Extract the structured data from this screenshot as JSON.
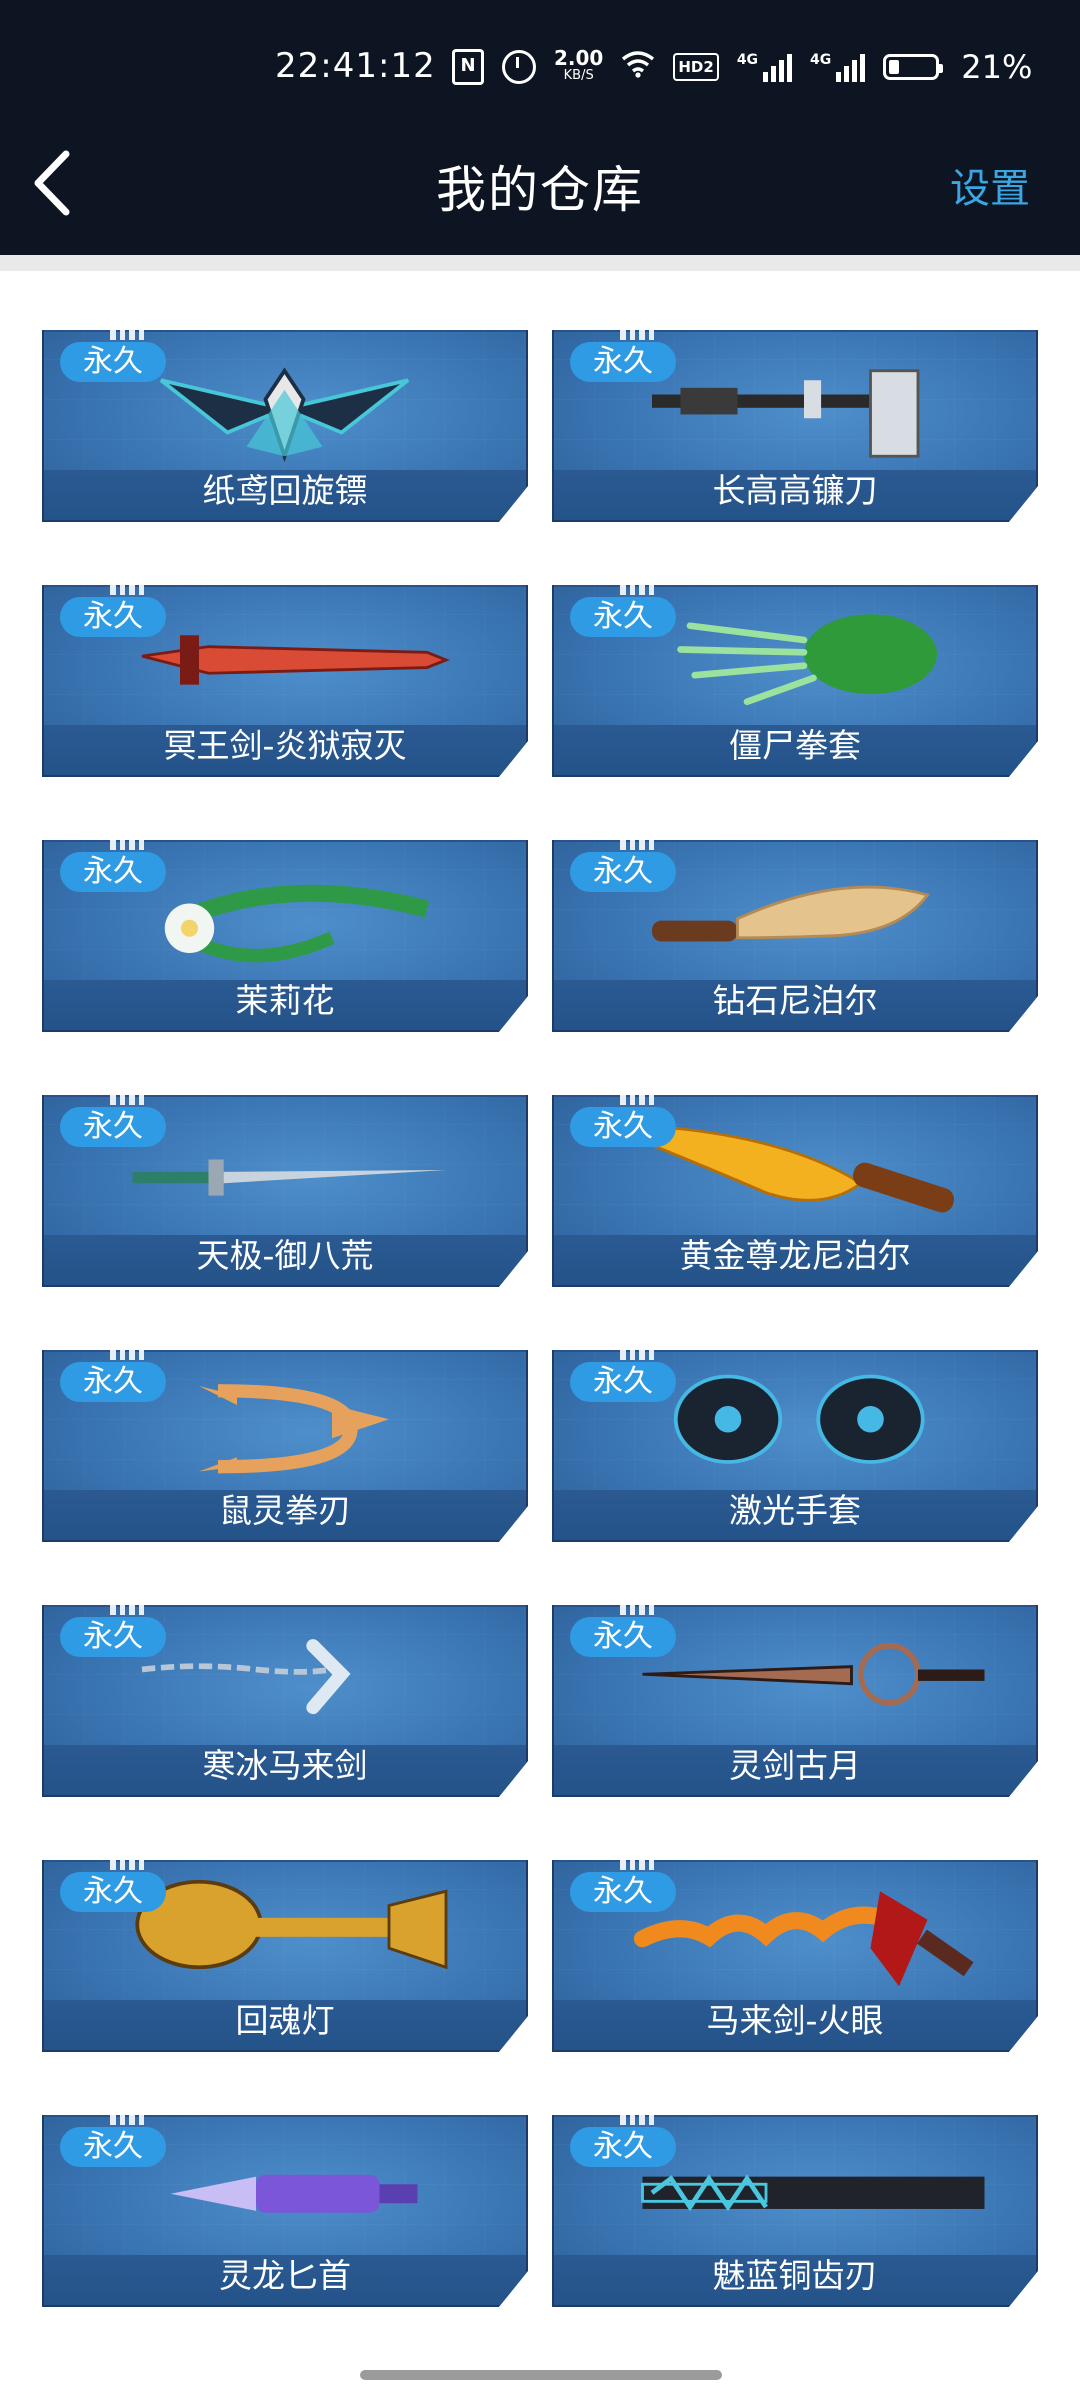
{
  "status_bar": {
    "time": "22:41:12",
    "nfc_label": "N",
    "speed_value": "2.00",
    "speed_unit": "KB/S",
    "hd_label": "HD2",
    "signal1_label": "4G",
    "signal2_label": "4G",
    "battery_percent": "21%",
    "battery_level": 0.21
  },
  "header": {
    "title": "我的仓库",
    "settings_label": "设置",
    "back_icon": "chevron-left-icon"
  },
  "badge_label": "永久",
  "items": [
    {
      "name": "纸鸢回旋镖",
      "color": "#1c2f44",
      "accent": "#47c7d7",
      "shape": "kite"
    },
    {
      "name": "长高高镰刀",
      "color": "#d7dde3",
      "accent": "#2a2a2a",
      "shape": "scythe"
    },
    {
      "name": "冥王剑-炎狱寂灭",
      "color": "#d94b34",
      "accent": "#7a1c15",
      "shape": "sword"
    },
    {
      "name": "僵尸拳套",
      "color": "#2e9a3a",
      "accent": "#9be29f",
      "shape": "claw"
    },
    {
      "name": "茉莉花",
      "color": "#2e9a48",
      "accent": "#f2f6f2",
      "shape": "flower"
    },
    {
      "name": "钻石尼泊尔",
      "color": "#e5c38d",
      "accent": "#6a3b1f",
      "shape": "kukri"
    },
    {
      "name": "天极-御八荒",
      "color": "#c9d3dd",
      "accent": "#2d7f69",
      "shape": "rapier"
    },
    {
      "name": "黄金尊龙尼泊尔",
      "color": "#f3b01f",
      "accent": "#7a3d16",
      "shape": "kukri-gold"
    },
    {
      "name": "鼠灵拳刃",
      "color": "#e6a25c",
      "accent": "#2b2b2b",
      "shape": "knuckle"
    },
    {
      "name": "激光手套",
      "color": "#1a2330",
      "accent": "#46b8e5",
      "shape": "gloves"
    },
    {
      "name": "寒冰马来剑",
      "color": "#dfe9f3",
      "accent": "#b8c7d6",
      "shape": "ice-sword"
    },
    {
      "name": "灵剑古月",
      "color": "#a46a52",
      "accent": "#2c1b16",
      "shape": "long-sword"
    },
    {
      "name": "回魂灯",
      "color": "#d9a22d",
      "accent": "#5a3c10",
      "shape": "lamp"
    },
    {
      "name": "马来剑-火眼",
      "color": "#f08a1f",
      "accent": "#b21818",
      "shape": "flame-sword"
    },
    {
      "name": "灵龙匕首",
      "color": "#7b56d8",
      "accent": "#c9bdf5",
      "shape": "dagger"
    },
    {
      "name": "魅蓝铜齿刃",
      "color": "#20232a",
      "accent": "#4ac6de",
      "shape": "saw"
    }
  ]
}
